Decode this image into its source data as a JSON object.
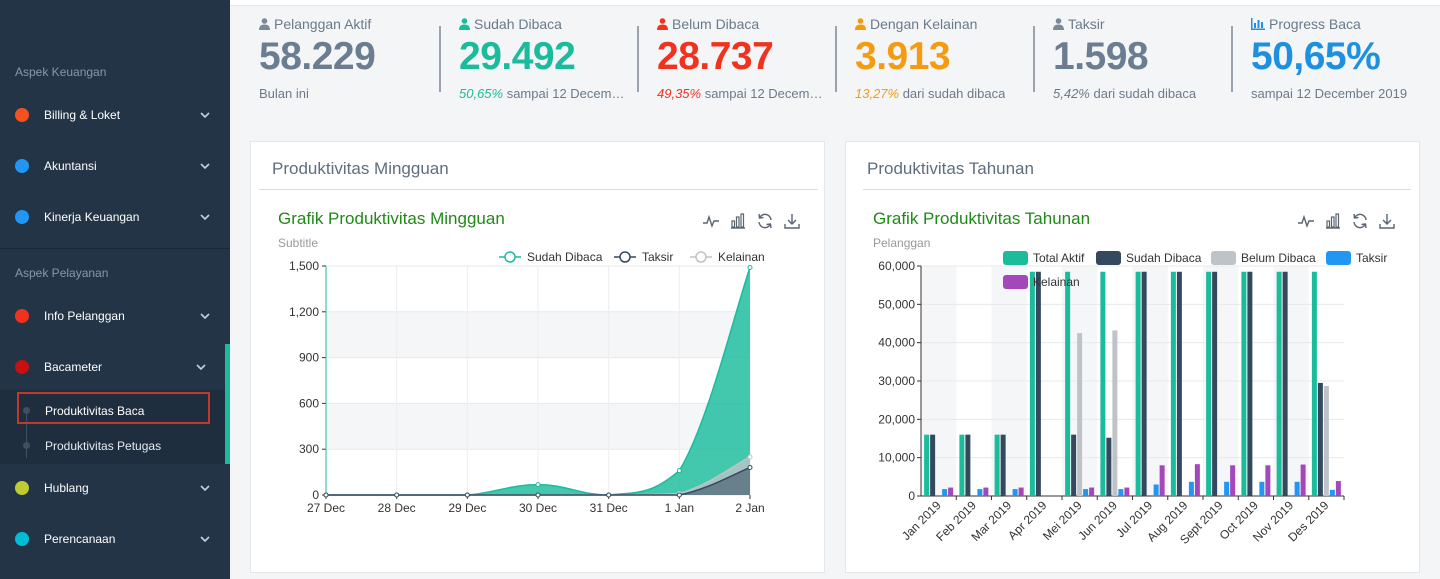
{
  "sidebar": {
    "section_finance": "Aspek Keuangan",
    "section_service": "Aspek Pelayanan",
    "items": [
      {
        "label": "Billing & Loket",
        "color": "#f4511e"
      },
      {
        "label": "Akuntansi",
        "color": "#2196f3"
      },
      {
        "label": "Kinerja Keuangan",
        "color": "#2196f3"
      },
      {
        "label": "Info Pelanggan",
        "color": "#f4311e"
      },
      {
        "label": "Bacameter",
        "color": "#c71010"
      },
      {
        "label": "Hublang",
        "color": "#c0ca33"
      },
      {
        "label": "Perencanaan",
        "color": "#00bcd4"
      }
    ],
    "submenu": [
      {
        "label": "Produktivitas Baca"
      },
      {
        "label": "Produktivitas Petugas"
      }
    ]
  },
  "stats": [
    {
      "label": "Pelanggan Aktif",
      "icon": "user-icon",
      "value": "58.229",
      "pct": "",
      "sub": "Bulan ini",
      "color": "#6b7d90"
    },
    {
      "label": "Sudah Dibaca",
      "icon": "user-icon",
      "value": "29.492",
      "pct": "50,65%",
      "sub": " sampai 12 Decem…",
      "color": "#1abc9c"
    },
    {
      "label": "Belum Dibaca",
      "icon": "user-icon",
      "value": "28.737",
      "pct": "49,35%",
      "sub": " sampai 12 Decem…",
      "color": "#f0321e"
    },
    {
      "label": "Dengan Kelainan",
      "icon": "user-icon",
      "value": "3.913",
      "pct": "13,27%",
      "sub": " dari sudah dibaca",
      "color": "#f39c12"
    },
    {
      "label": "Taksir",
      "icon": "user-icon",
      "value": "1.598",
      "pct": "5,42%",
      "sub": " dari sudah dibaca",
      "color": "#6b7d90"
    },
    {
      "label": "Progress Baca",
      "icon": "bar-chart-icon",
      "value": "50,65%",
      "pct": "",
      "sub": "sampai 12 December 2019",
      "color": "#1e90e0"
    }
  ],
  "weekly": {
    "card_title": "Produktivitas Mingguan",
    "chart_title": "Grafik Produktivitas Mingguan",
    "chart_subtitle": "Subtitle"
  },
  "yearly": {
    "card_title": "Produktivitas Tahunan",
    "chart_title": "Grafik Produktivitas Tahunan",
    "chart_subtitle": "Pelanggan"
  },
  "chart_data": [
    {
      "type": "area",
      "title": "Grafik Produktivitas Mingguan",
      "subtitle": "Subtitle",
      "x": [
        "27 Dec",
        "28 Dec",
        "29 Dec",
        "30 Dec",
        "31 Dec",
        "1 Jan",
        "2 Jan"
      ],
      "ylim": [
        0,
        1500
      ],
      "yticks": [
        0,
        300,
        600,
        900,
        1200,
        1500
      ],
      "ytick_labels": [
        "0",
        "300",
        "600",
        "900",
        "1,200",
        "1,500"
      ],
      "grid": true,
      "legend_position": "top-right",
      "series": [
        {
          "name": "Sudah Dibaca",
          "color": "#1abc9c",
          "values": [
            0,
            0,
            0,
            68,
            0,
            160,
            1490
          ]
        },
        {
          "name": "Taksir",
          "color": "#34495e",
          "values": [
            0,
            0,
            0,
            0,
            0,
            0,
            180
          ]
        },
        {
          "name": "Kelainan",
          "color": "#bdc3c7",
          "values": [
            0,
            0,
            0,
            0,
            0,
            10,
            250
          ]
        }
      ]
    },
    {
      "type": "bar",
      "title": "Grafik Produktivitas Tahunan",
      "subtitle": "Pelanggan",
      "categories": [
        "Jan 2019",
        "Feb 2019",
        "Mar 2019",
        "Apr 2019",
        "Mei 2019",
        "Jun 2019",
        "Jul 2019",
        "Aug 2019",
        "Sept 2019",
        "Oct 2019",
        "Nov 2019",
        "Des 2019"
      ],
      "ylim": [
        0,
        60000
      ],
      "yticks": [
        0,
        10000,
        20000,
        30000,
        40000,
        50000,
        60000
      ],
      "ytick_labels": [
        "0",
        "10,000",
        "20,000",
        "30,000",
        "40,000",
        "50,000",
        "60,000"
      ],
      "grid": true,
      "legend_position": "top",
      "series": [
        {
          "name": "Total Aktif",
          "color": "#1abc9c",
          "values": [
            16000,
            16000,
            16000,
            58500,
            58500,
            58500,
            58500,
            58500,
            58500,
            58500,
            58500,
            58500
          ]
        },
        {
          "name": "Sudah Dibaca",
          "color": "#34495e",
          "values": [
            16000,
            16000,
            16000,
            58500,
            16000,
            15200,
            58500,
            58500,
            58500,
            58500,
            58500,
            29500
          ]
        },
        {
          "name": "Belum Dibaca",
          "color": "#bdc3c7",
          "values": [
            0,
            0,
            0,
            0,
            42500,
            43200,
            0,
            0,
            0,
            0,
            0,
            28700
          ]
        },
        {
          "name": "Taksir",
          "color": "#2196f3",
          "values": [
            1800,
            1800,
            1800,
            0,
            1800,
            1800,
            3000,
            3700,
            3700,
            3700,
            3700,
            1600
          ]
        },
        {
          "name": "Kelainan",
          "color": "#a347ba",
          "values": [
            2200,
            2200,
            2200,
            0,
            2200,
            2200,
            8000,
            8300,
            8000,
            8000,
            8200,
            3900
          ]
        }
      ]
    }
  ]
}
